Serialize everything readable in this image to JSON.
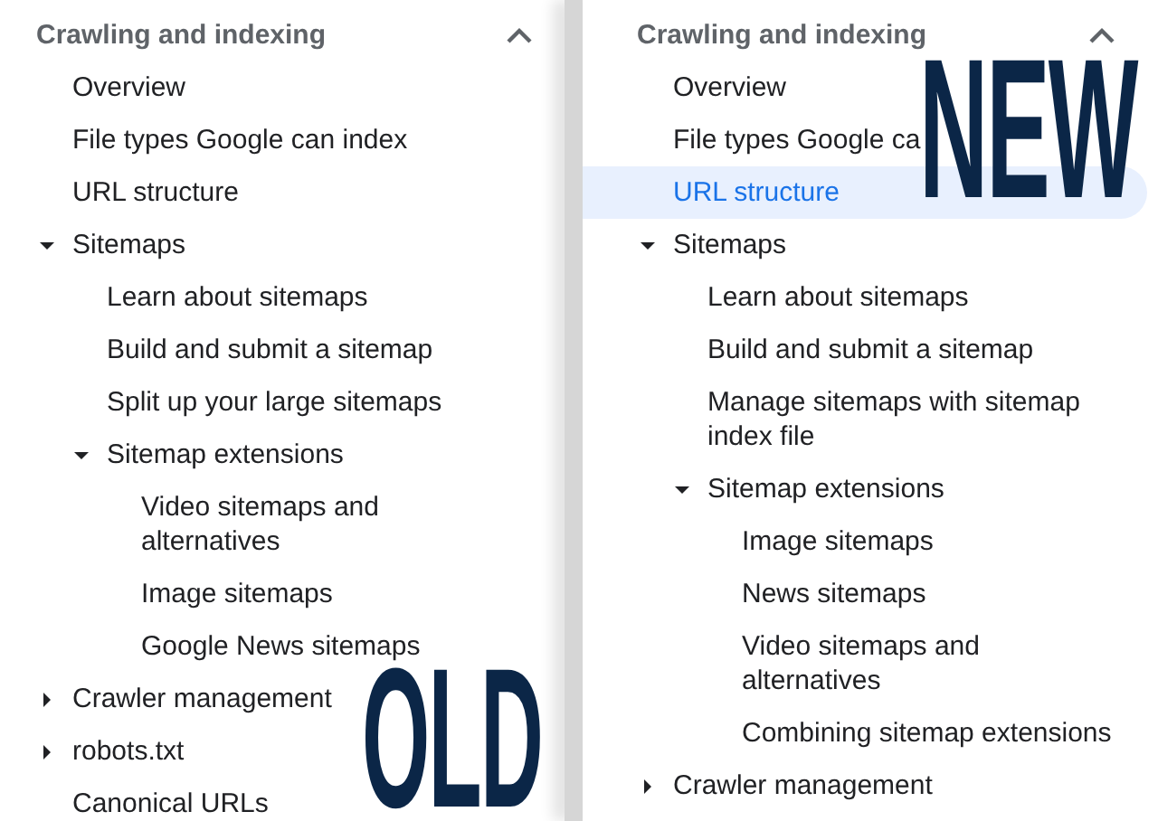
{
  "panels": [
    {
      "overlay_label": "OLD",
      "heading": "Crawling and indexing",
      "expanded": true,
      "items": [
        {
          "label": "Overview",
          "selected": false
        },
        {
          "label": "File types Google can index",
          "selected": false
        },
        {
          "label": "URL structure",
          "selected": false
        },
        {
          "label": "Sitemaps",
          "selected": false,
          "expanded": true,
          "children": [
            {
              "label": "Learn about sitemaps",
              "selected": false
            },
            {
              "label": "Build and submit a sitemap",
              "selected": false
            },
            {
              "label": "Split up your large sitemaps",
              "selected": false
            },
            {
              "label": "Sitemap extensions",
              "selected": false,
              "expanded": true,
              "children": [
                {
                  "label": "Video sitemaps and alternatives",
                  "selected": false
                },
                {
                  "label": "Image sitemaps",
                  "selected": false
                },
                {
                  "label": "Google News sitemaps",
                  "selected": false
                }
              ]
            }
          ]
        },
        {
          "label": "Crawler management",
          "selected": false,
          "expanded": false
        },
        {
          "label": "robots.txt",
          "selected": false,
          "expanded": false
        },
        {
          "label": "Canonical URLs",
          "selected": false
        }
      ]
    },
    {
      "overlay_label": "NEW",
      "heading": "Crawling and indexing",
      "expanded": true,
      "items": [
        {
          "label": "Overview",
          "selected": false
        },
        {
          "label": "File types Google ca",
          "selected": false
        },
        {
          "label": "URL structure",
          "selected": true
        },
        {
          "label": "Sitemaps",
          "selected": false,
          "expanded": true,
          "children": [
            {
              "label": "Learn about sitemaps",
              "selected": false
            },
            {
              "label": "Build and submit a sitemap",
              "selected": false
            },
            {
              "label": "Manage sitemaps with sitemap index file",
              "selected": false
            },
            {
              "label": "Sitemap extensions",
              "selected": false,
              "expanded": true,
              "children": [
                {
                  "label": "Image sitemaps",
                  "selected": false
                },
                {
                  "label": "News sitemaps",
                  "selected": false
                },
                {
                  "label": "Video sitemaps and alternatives",
                  "selected": false
                },
                {
                  "label": "Combining sitemap extensions",
                  "selected": false
                }
              ]
            }
          ]
        },
        {
          "label": "Crawler management",
          "selected": false,
          "expanded": false
        }
      ]
    }
  ]
}
